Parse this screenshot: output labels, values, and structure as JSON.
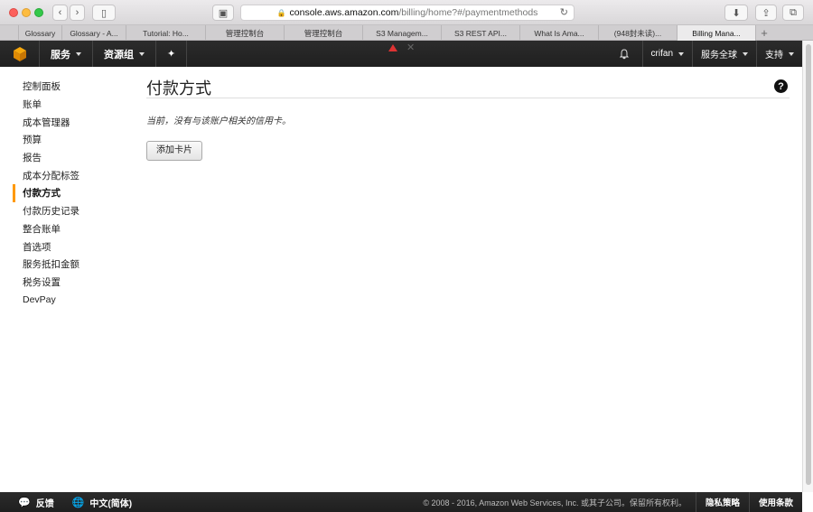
{
  "browser": {
    "url_host": "console.aws.amazon.com",
    "url_path": "/billing/home?#/paymentmethods",
    "tabs": [
      "Glossary",
      "Glossary - A...",
      "Tutorial: Ho...",
      "管理控制台",
      "管理控制台",
      "S3 Managem...",
      "S3 REST API...",
      "What Is Ama...",
      "(948封未读)...",
      "Billing Mana..."
    ],
    "active_tab_index": 9
  },
  "nav": {
    "services": "服务",
    "resource_groups": "资源组",
    "user": "crifan",
    "region": "服务全球",
    "support": "支持"
  },
  "sidebar": {
    "items": [
      "控制面板",
      "账单",
      "成本管理器",
      "预算",
      "报告",
      "成本分配标签",
      "付款方式",
      "付款历史记录",
      "整合账单",
      "首选项",
      "服务抵扣金额",
      "税务设置",
      "DevPay"
    ],
    "active_index": 6
  },
  "main": {
    "title": "付款方式",
    "message": "当前，没有与该账户相关的信用卡。",
    "add_card_label": "添加卡片"
  },
  "footer": {
    "feedback": "反馈",
    "language": "中文(简体)",
    "copyright": "© 2008 - 2016, Amazon Web Services, Inc. 或其子公司。保留所有权利。",
    "privacy": "隐私策略",
    "terms": "使用条款"
  },
  "colors": {
    "nav_bg": "#1f1f1f",
    "active_accent": "#ff9900"
  }
}
